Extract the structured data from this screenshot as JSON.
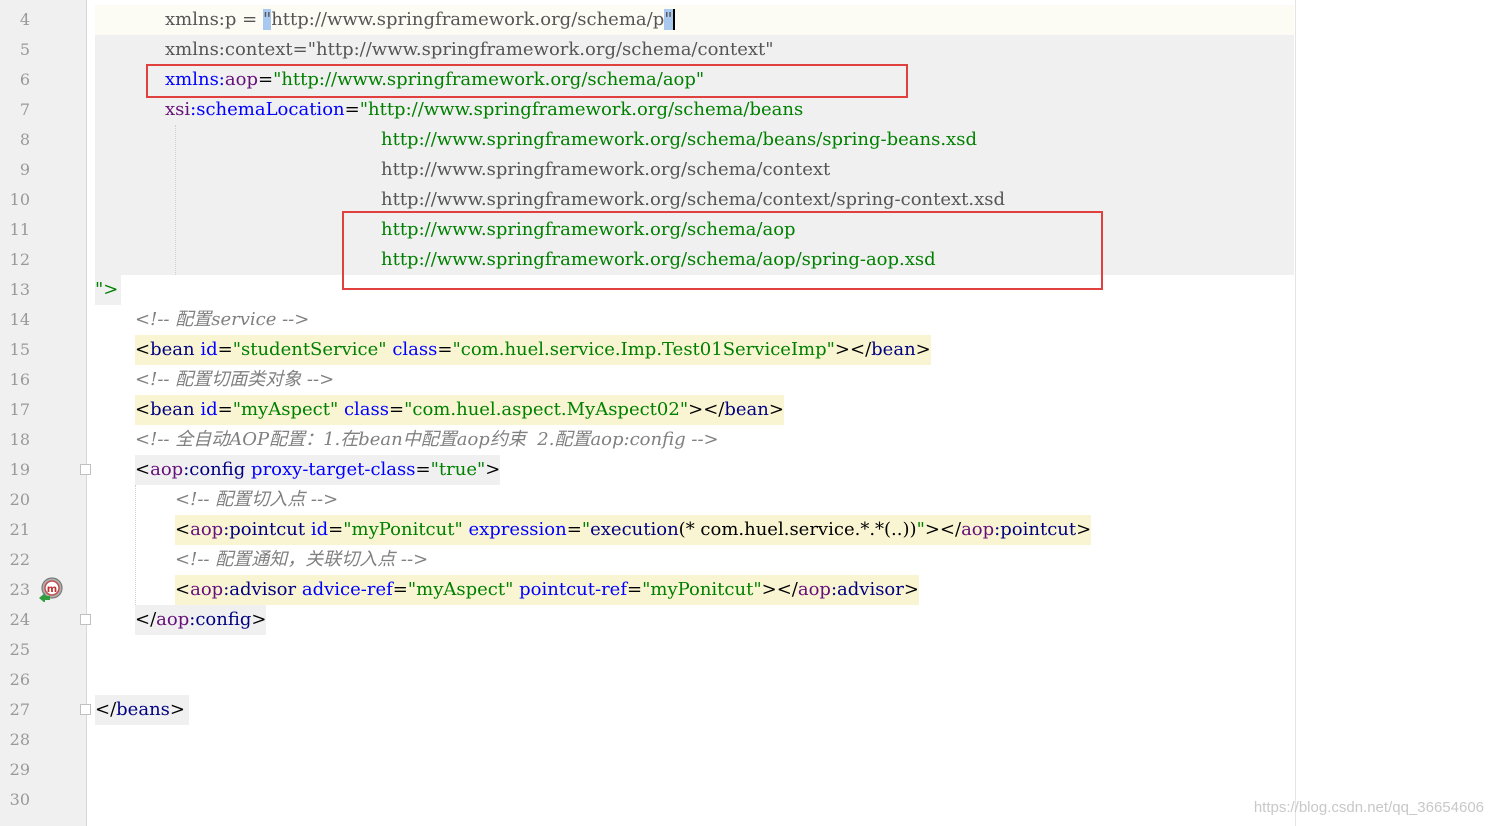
{
  "gutter": {
    "line_numbers": [
      "4",
      "5",
      "6",
      "7",
      "8",
      "9",
      "10",
      "11",
      "12",
      "13",
      "14",
      "15",
      "16",
      "17",
      "18",
      "19",
      "20",
      "21",
      "22",
      "23",
      "24",
      "25",
      "26",
      "27",
      "28",
      "29",
      "30"
    ]
  },
  "code": {
    "l4": {
      "attr": "xmlns:p",
      "eq": " = ",
      "q1": "\"",
      "url": "http://www.springframework.org/schema/p",
      "q2": "\""
    },
    "l5": {
      "attr": "xmlns:context=",
      "url": "\"http://www.springframework.org/schema/context\""
    },
    "l6": {
      "ns": "xmlns:",
      "prefix": "aop",
      "eq": "=",
      "val": "\"http://www.springframework.org/schema/aop\""
    },
    "l7": {
      "ns": "xsi",
      "colon": ":",
      "attr": "schemaLocation",
      "eq": "=",
      "val": "\"http://www.springframework.org/schema/beans"
    },
    "l8": "http://www.springframework.org/schema/beans/spring-beans.xsd",
    "l9": "http://www.springframework.org/schema/context",
    "l10": "http://www.springframework.org/schema/context/spring-context.xsd",
    "l11": "http://www.springframework.org/schema/aop",
    "l12": "http://www.springframework.org/schema/aop/spring-aop.xsd",
    "l13": "\">",
    "l14": "<!-- 配置service -->",
    "l15": {
      "open": "<",
      "tag": "bean",
      "a1": "id",
      "e1": "=",
      "v1": "\"studentService\"",
      "a2": "class",
      "e2": "=",
      "v2": "\"com.huel.service.Imp.Test01ServiceImp\"",
      "close": "></",
      "ctag": "bean",
      "end": ">"
    },
    "l16": "<!-- 配置切面类对象 -->",
    "l17": {
      "open": "<",
      "tag": "bean",
      "a1": "id",
      "e1": "=",
      "v1": "\"myAspect\"",
      "a2": "class",
      "e2": "=",
      "v2": "\"com.huel.aspect.MyAspect02\"",
      "close": "></",
      "ctag": "bean",
      "end": ">"
    },
    "l18": "<!-- 全自动AOP配置：1.在bean中配置aop约束  2.配置aop:config -->",
    "l19": {
      "open": "<",
      "ns": "aop",
      "colon": ":",
      "tag": "config",
      "a1": "proxy-target-class",
      "e1": "=",
      "v1": "\"true\"",
      "end": ">"
    },
    "l20": "<!-- 配置切入点 -->",
    "l21": {
      "open": "<",
      "ns": "aop",
      "colon": ":",
      "tag": "pointcut",
      "a1": "id",
      "e1": "=",
      "v1": "\"myPonitcut\"",
      "a2": "expression",
      "e2": "=",
      "v2a": "\"",
      "v2b": "execution",
      "v2c": "(* com.huel.service.*.*(..))",
      "v2d": "\"",
      "close": "></",
      "cns": "aop",
      "ccolon": ":",
      "ctag": "pointcut",
      "end": ">"
    },
    "l22": "<!-- 配置通知，关联切入点 -->",
    "l23": {
      "open": "<",
      "ns": "aop",
      "colon": ":",
      "tag": "advisor",
      "a1": "advice-ref",
      "e1": "=",
      "v1": "\"myAspect\"",
      "a2": "pointcut-ref",
      "e2": "=",
      "v2": "\"myPonitcut\"",
      "close": "></",
      "cns": "aop",
      "ccolon": ":",
      "ctag": "advisor",
      "end": ">"
    },
    "l24": {
      "open": "</",
      "ns": "aop",
      "colon": ":",
      "tag": "config",
      "end": ">"
    },
    "l27": {
      "open": "</",
      "tag": "beans",
      "end": ">"
    }
  },
  "gutter_icon": "implemented-method-icon",
  "marker_color": "#e0403e",
  "watermark": "https://blog.csdn.net/qq_36654606"
}
